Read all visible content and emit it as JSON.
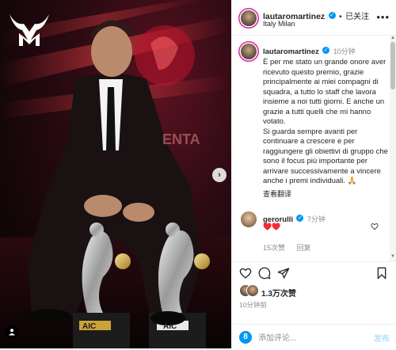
{
  "media": {
    "logo_icon": "mt-bull-logo-icon",
    "backdrop_text_1": "ENTA",
    "trophy_label_left": "AIC",
    "trophy_label_right": "AIC"
  },
  "header": {
    "username": "lautaromartinez",
    "separator": "•",
    "follow_label": "已关注",
    "location": "Italy Milan",
    "more_icon": "more-horizontal-icon"
  },
  "caption": {
    "username": "lautaromartinez",
    "time": "10分钟",
    "text": "È per me stato un grande onore aver ricevuto questo premio, grazie principalmente ai miei compagni di squadra, a tutto lo staff che lavora insieme a noi tutti giorni. E anche un grazie a tutti quelli che mi hanno votato.\nSi guarda sempre avanti per continuare a crescere e per raggiungere gli obiettivi di gruppo che sono il focus più importante per arrivare successivamente a vincere anche i premi individuali. 🙏",
    "translate_label": "查看翻译"
  },
  "comment": {
    "username": "gerorulli",
    "time": "7分钟",
    "text": "♥️♥️",
    "likes": "15次赞",
    "reply_label": "回复"
  },
  "actions": {
    "likes_label": "1.3万次赞",
    "time_label": "10分钟前"
  },
  "comment_bar": {
    "placeholder": "添加评论...",
    "post_label": "发布"
  },
  "colors": {
    "accent": "#0095f6",
    "heart": "#ed4956",
    "stage_red": "#c0122e"
  }
}
